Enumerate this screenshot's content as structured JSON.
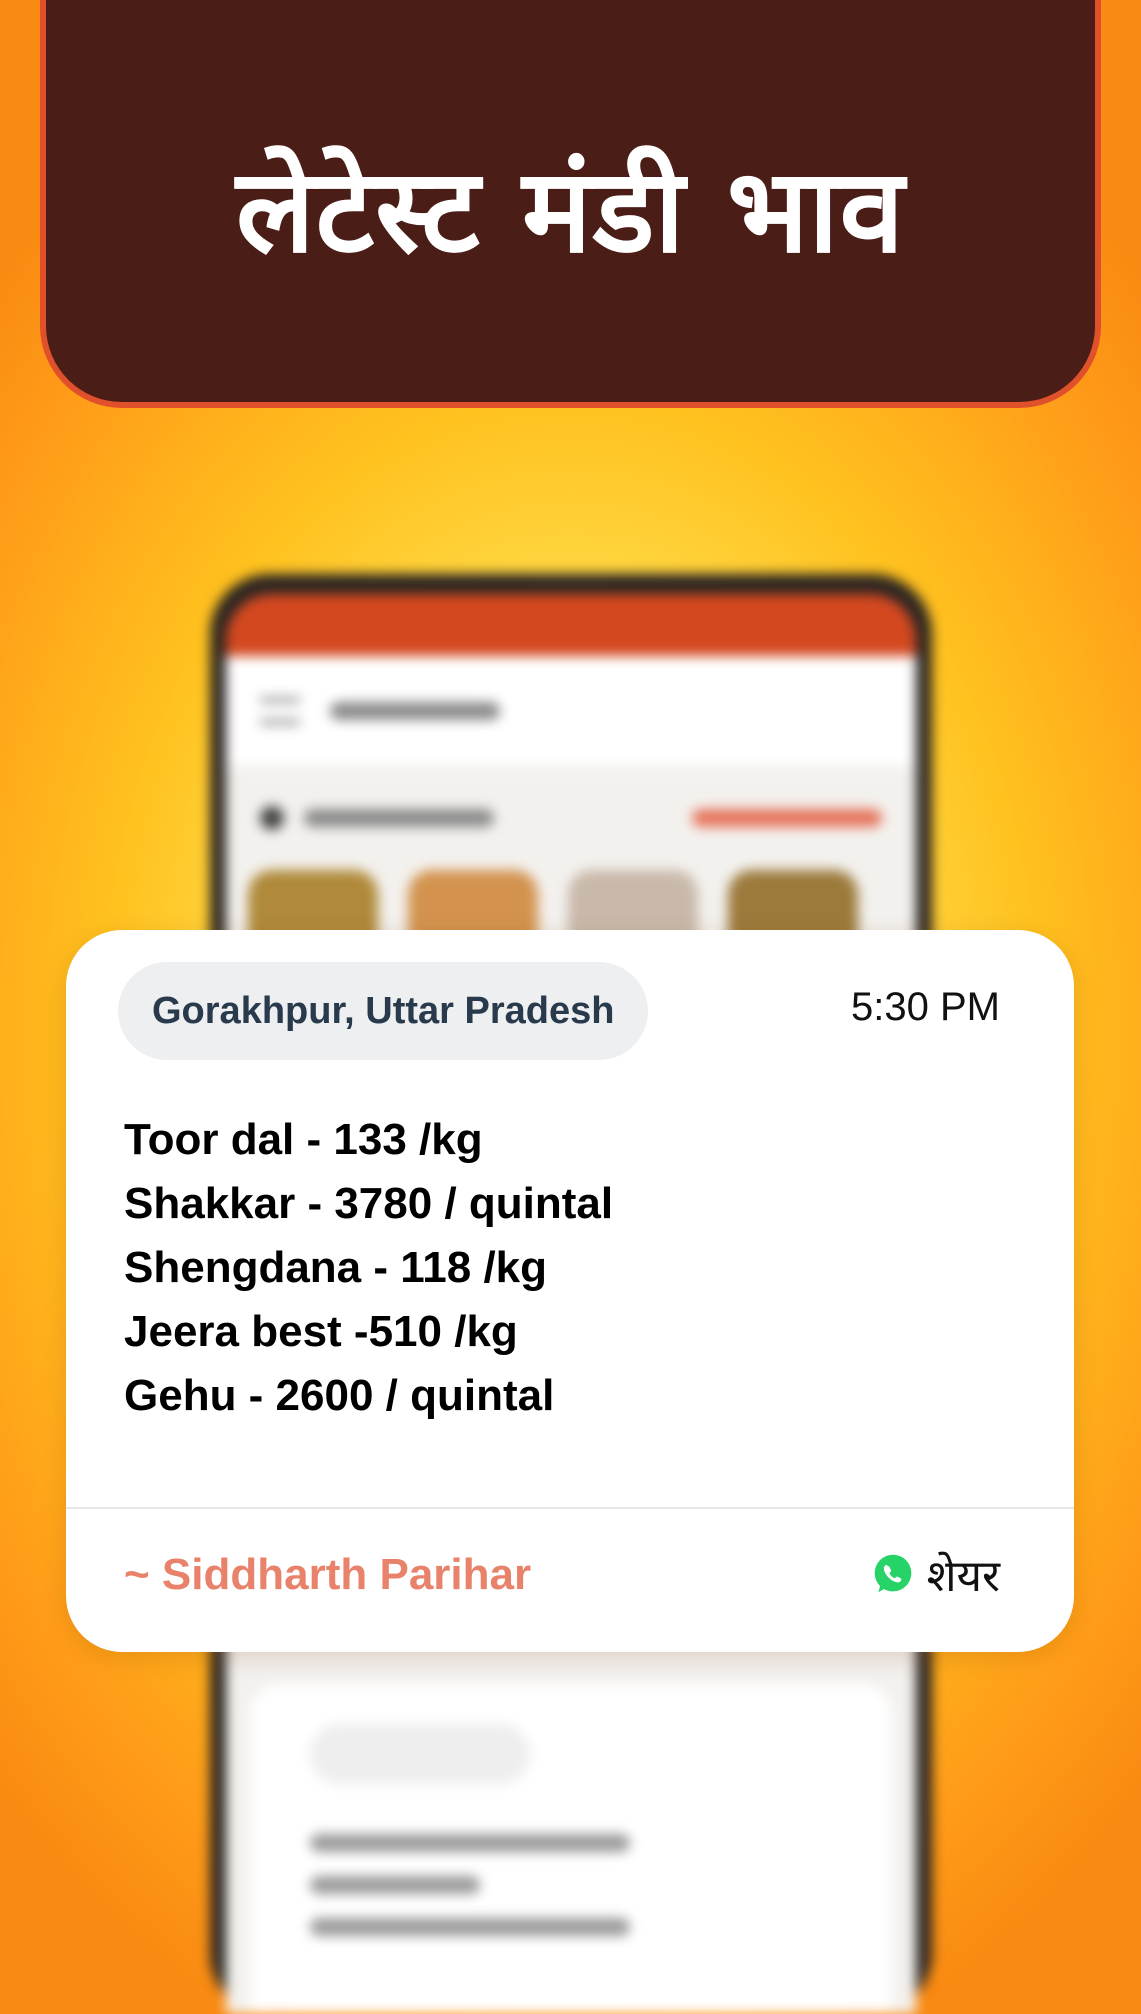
{
  "banner": {
    "title": "लेटेस्ट मंडी भाव"
  },
  "card": {
    "location": "Gorakhpur, Uttar Pradesh",
    "time": "5:30 PM",
    "items": [
      "Toor dal - 133 /kg",
      "Shakkar - 3780 / quintal",
      "Shengdana - 118 /kg",
      "Jeera best -510 /kg",
      "Gehu - 2600 / quintal"
    ],
    "author": "~ Siddharth Parihar",
    "share_label": "शेयर",
    "share_icon": "whatsapp-icon"
  },
  "colors": {
    "banner_bg": "#4a1d17",
    "banner_border": "#e0502a",
    "author": "#e8826a",
    "whatsapp": "#25d366"
  }
}
